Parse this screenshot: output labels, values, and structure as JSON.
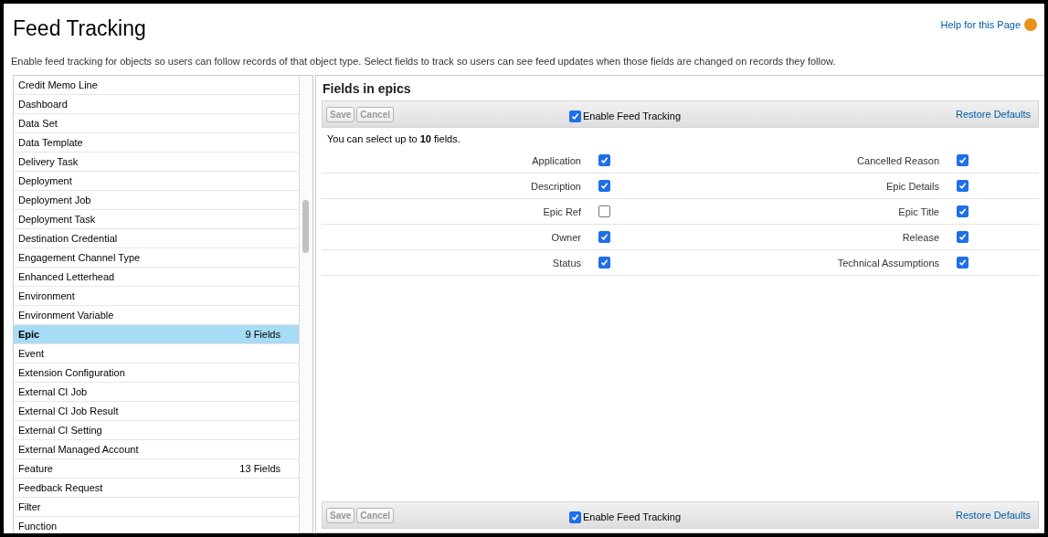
{
  "page": {
    "title": "Feed Tracking",
    "help_link": "Help for this Page",
    "description": "Enable feed tracking for objects so users can follow records of that object type. Select fields to track so users can see feed updates when those fields are changed on records they follow."
  },
  "objects": [
    {
      "name": "Credit Memo Line",
      "selected": false
    },
    {
      "name": "Dashboard",
      "selected": false
    },
    {
      "name": "Data Set",
      "selected": false
    },
    {
      "name": "Data Template",
      "selected": false
    },
    {
      "name": "Delivery Task",
      "selected": false
    },
    {
      "name": "Deployment",
      "selected": false
    },
    {
      "name": "Deployment Job",
      "selected": false
    },
    {
      "name": "Deployment Task",
      "selected": false
    },
    {
      "name": "Destination Credential",
      "selected": false
    },
    {
      "name": "Engagement Channel Type",
      "selected": false
    },
    {
      "name": "Enhanced Letterhead",
      "selected": false
    },
    {
      "name": "Environment",
      "selected": false
    },
    {
      "name": "Environment Variable",
      "selected": false
    },
    {
      "name": "Epic",
      "count": "9 Fields",
      "selected": true
    },
    {
      "name": "Event",
      "selected": false
    },
    {
      "name": "Extension Configuration",
      "selected": false
    },
    {
      "name": "External CI Job",
      "selected": false
    },
    {
      "name": "External CI Job Result",
      "selected": false
    },
    {
      "name": "External CI Setting",
      "selected": false
    },
    {
      "name": "External Managed Account",
      "selected": false
    },
    {
      "name": "Feature",
      "count": "13 Fields",
      "selected": false
    },
    {
      "name": "Feedback Request",
      "selected": false
    },
    {
      "name": "Filter",
      "selected": false
    },
    {
      "name": "Function",
      "selected": false
    }
  ],
  "fields_panel": {
    "title": "Fields in epics",
    "top_toolbar": {
      "buttons": [
        {
          "label": "Save",
          "disabled": true
        },
        {
          "label": "Cancel",
          "disabled": true
        }
      ],
      "enable_label": "Enable Feed Tracking",
      "enable_checked": true,
      "restore": "Restore Defaults"
    },
    "limit_note": "You can select up to **10** fields.",
    "rows": [
      [
        {
          "label": "Application",
          "checked": true
        },
        {
          "label": "Cancelled Reason",
          "checked": true
        }
      ],
      [
        {
          "label": "Description",
          "checked": true
        },
        {
          "label": "Epic Details",
          "checked": true
        }
      ],
      [
        {
          "label": "Epic Ref",
          "checked": false
        },
        {
          "label": "Epic Title",
          "checked": true
        }
      ],
      [
        {
          "label": "Owner",
          "checked": true
        },
        {
          "label": "Release",
          "checked": true
        }
      ],
      [
        {
          "label": "Status",
          "checked": true
        },
        {
          "label": "Technical Assumptions",
          "checked": true
        }
      ]
    ],
    "bottom_toolbar": {
      "buttons": [
        {
          "label": "Save",
          "disabled": true
        },
        {
          "label": "Cancel",
          "disabled": true
        }
      ],
      "enable_label": "Enable Feed Tracking",
      "enable_checked": true,
      "restore": "Restore Defaults"
    }
  }
}
